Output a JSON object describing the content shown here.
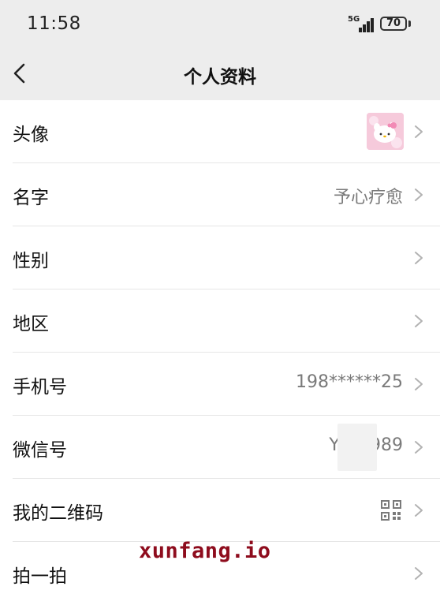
{
  "status_bar": {
    "time": "11:58",
    "network": "5G",
    "battery": "70"
  },
  "nav": {
    "title": "个人资料",
    "back_icon": "chevron-left-icon"
  },
  "profile_rows": [
    {
      "label": "头像",
      "value": "",
      "trailing": "avatar-image"
    },
    {
      "label": "名字",
      "value": "予心疗愈"
    },
    {
      "label": "性别",
      "value": ""
    },
    {
      "label": "地区",
      "value": ""
    },
    {
      "label": "手机号",
      "value": "198******25"
    },
    {
      "label": "微信号",
      "value": "YUV        989",
      "note": "partially obscured"
    },
    {
      "label": "我的二维码",
      "value": "",
      "trailing": "qr-code-icon"
    },
    {
      "label": "拍一拍",
      "value": ""
    }
  ],
  "watermark": "xunfang.io",
  "colors": {
    "header_bg": "#ededed",
    "list_bg": "#ffffff",
    "label_text": "#111111",
    "value_text": "#7a7a7a",
    "divider": "#e6e6e6",
    "watermark": "#8e0c1d"
  }
}
